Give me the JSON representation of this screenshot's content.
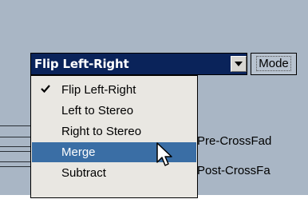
{
  "dropdown": {
    "selected": "Flip Left-Right",
    "options": [
      {
        "label": "Flip Left-Right",
        "checked": true
      },
      {
        "label": "Left to Stereo",
        "checked": false
      },
      {
        "label": "Right to Stereo",
        "checked": false
      },
      {
        "label": "Merge",
        "checked": false,
        "highlighted": true
      },
      {
        "label": "Subtract",
        "checked": false
      }
    ]
  },
  "mode_button": {
    "label": "Mode"
  },
  "labels": {
    "pre_crossfade": "Pre-CrossFad",
    "post_crossfade": "Post-CrossFa"
  },
  "colors": {
    "panel": "#a9b6c5",
    "combo_bg": "#0a235a",
    "highlight": "#3a6ea5",
    "menu_bg": "#e9e7e2"
  },
  "icons": {
    "check": "checkmark-icon",
    "arrow": "chevron-down-icon",
    "cursor": "mouse-pointer-icon"
  }
}
